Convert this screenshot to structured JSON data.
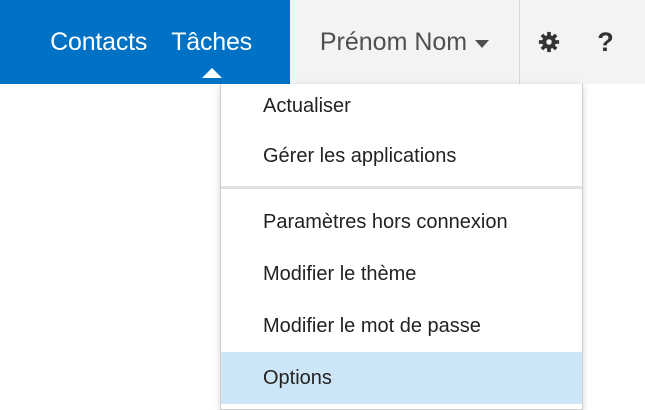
{
  "nav": {
    "contacts_label": "Contacts",
    "tasks_label": "Tâches"
  },
  "user": {
    "name": "Prénom Nom"
  },
  "header_icons": {
    "settings_icon": "gear-icon",
    "help_label": "?"
  },
  "menu": {
    "items": [
      {
        "label": "Actualiser"
      },
      {
        "label": "Gérer les applications"
      },
      {
        "label": "Paramètres hors connexion"
      },
      {
        "label": "Modifier le thème"
      },
      {
        "label": "Modifier le mot de passe"
      },
      {
        "label": "Options"
      }
    ],
    "selected": "Options"
  },
  "colors": {
    "nav_blue": "#0072c6",
    "header_gray": "#f3f3f3",
    "selected_bg": "#cde6f7"
  }
}
